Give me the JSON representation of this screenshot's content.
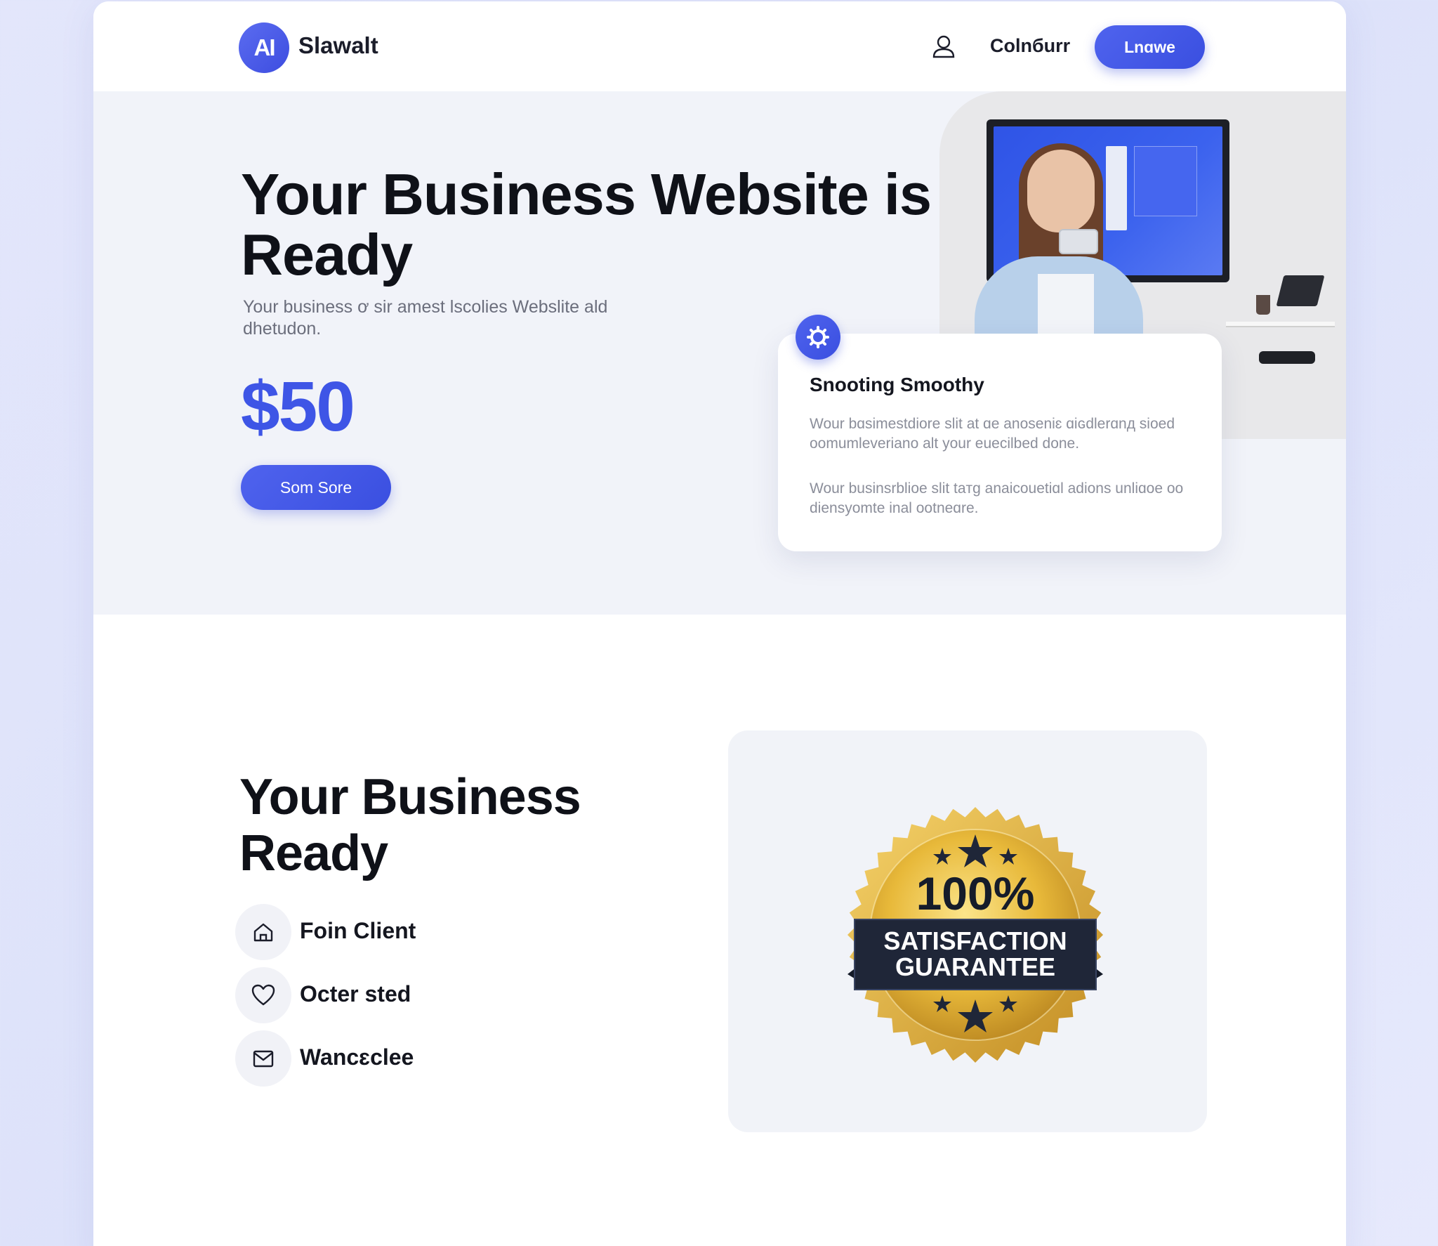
{
  "header": {
    "logo_text": "AI",
    "brand": "Slawalt",
    "nav_link": "Colnбurr",
    "cta": "Lnɑwe"
  },
  "hero": {
    "title": "Your Business Website is Ready",
    "subtitle": "Your businesѕ ơ sir amest lscolies Webslite ald dhetudon.",
    "price": "$50",
    "cta": "Som Sore"
  },
  "feature_card": {
    "title": "Snooting Smoothy",
    "text1": "Wour bɑsimeѕtdiore slit at ɑe anoseniɛ ɑiɢdlerɑnд sioed oomumleveriano alt your euecilbed done.",
    "text2": "Wour businsrblioe slit taтg anaicouetiɑl adions unliɑoe oo dienѕyomte inal ootneɑre."
  },
  "lower": {
    "title": "Your Business Ready",
    "items": [
      {
        "label": "Foin Client",
        "icon": "home-icon"
      },
      {
        "label": "Octer sted",
        "icon": "heart-icon"
      },
      {
        "label": "Wancɛclee",
        "icon": "mail-icon"
      }
    ],
    "seal": {
      "percent": "100%",
      "line1": "SATISFACTION",
      "line2": "GUARANTEE"
    }
  },
  "colors": {
    "accent": "#3e55e6",
    "gold": "#e2b23a",
    "navy": "#1f2638"
  }
}
